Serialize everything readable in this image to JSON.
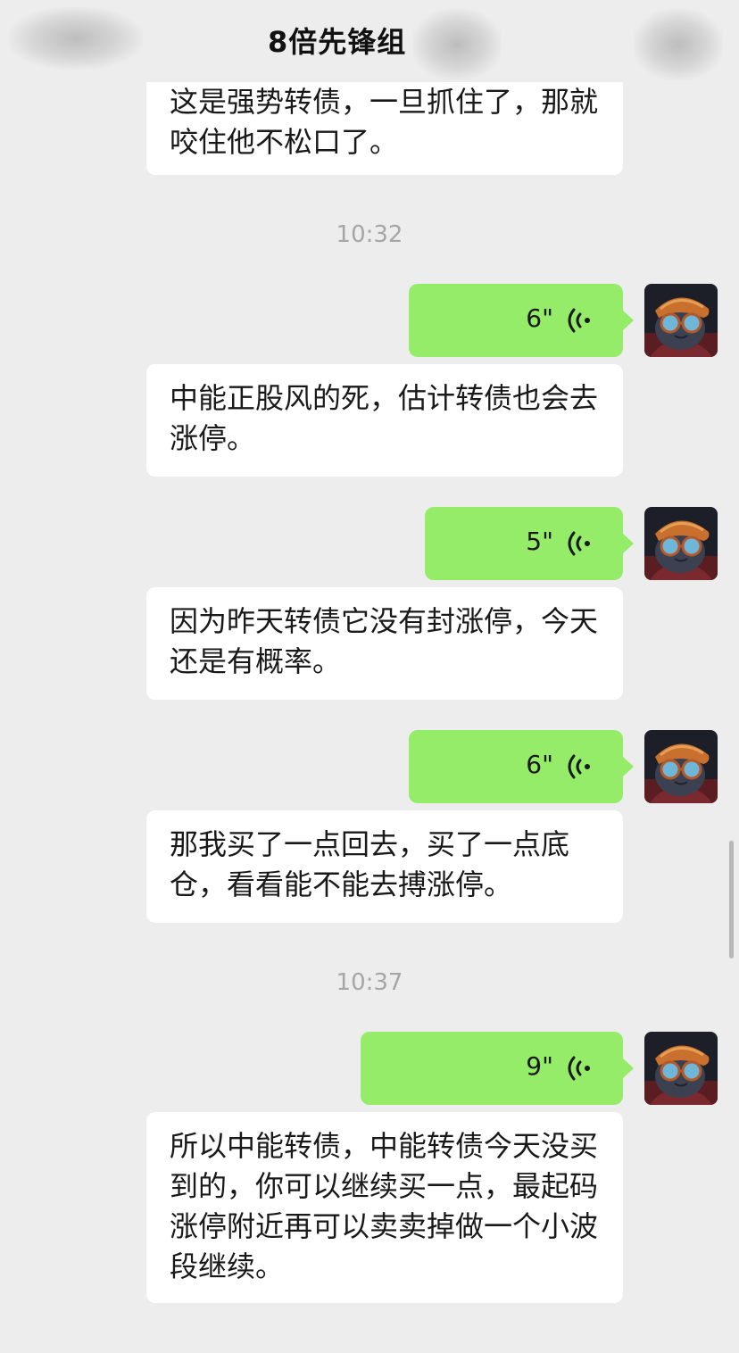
{
  "header": {
    "title": "8倍先锋组"
  },
  "messages": {
    "m0": "这是强势转债，一旦抓住了，那就咬住他不松口了。",
    "t1": "10:32",
    "v1": "6\"",
    "m1": "中能正股风的死，估计转债也会去涨停。",
    "v2": "5\"",
    "m2": "因为昨天转债它没有封涨停，今天还是有概率。",
    "v3": "6\"",
    "m3": "那我买了一点回去，买了一点底仓，看看能不能去搏涨停。",
    "t2": "10:37",
    "v4": "9\"",
    "m4": "所以中能转债，中能转债今天没买到的，你可以继续买一点，最起码涨停附近再可以卖卖掉做一个小波段继续。"
  },
  "colors": {
    "background": "#ededed",
    "outgoing_bubble": "#95ec69",
    "incoming_bubble": "#ffffff",
    "timestamp": "#a6a6a6"
  },
  "icons": {
    "voice": "voice-wave-icon",
    "avatar": "cat-with-glasses-avatar"
  }
}
